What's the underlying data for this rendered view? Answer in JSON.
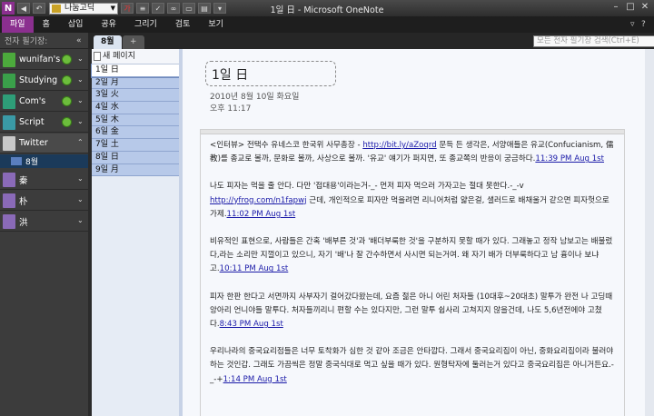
{
  "app": {
    "title": "1일 日 - Microsoft OneNote",
    "icon_letter": "N",
    "font_box": "나눔고딕"
  },
  "ribbon": {
    "tabs": [
      "파일",
      "홈",
      "삽입",
      "공유",
      "그리기",
      "검토",
      "보기"
    ]
  },
  "nav": {
    "header": "전자 필기장:",
    "notebooks": [
      {
        "name": "wunifan's",
        "color": "#4caa3c"
      },
      {
        "name": "Studying",
        "color": "#3aa04a"
      },
      {
        "name": "Com's",
        "color": "#2e9e78"
      },
      {
        "name": "Script",
        "color": "#3a9aa6"
      },
      {
        "name": "Twitter",
        "color": "#c8c8c8"
      }
    ],
    "twitter_section": "8월",
    "other_sections": [
      "秦",
      "朴",
      "洪"
    ]
  },
  "sections": {
    "tabs": [
      "8월",
      "+"
    ],
    "search_placeholder": "모든 전자 필기장 검색(Ctrl+E)"
  },
  "pages": {
    "add_label": "새 페이지",
    "items": [
      "1일 日",
      "2일 月",
      "3일 火",
      "4일 水",
      "5일 木",
      "6일 金",
      "7일 土",
      "8일 日",
      "9일 月"
    ]
  },
  "page": {
    "title": "1일 日",
    "date": "2010년 8월 10일 화요일",
    "time": "오후 11:17",
    "paragraphs": [
      {
        "text": "<인터뷰> 전택수 유네스코 한국위 사무총장 - ",
        "link": "http://bit.ly/aZoqrd",
        "rest": " 문득 든 생각은, 서양애들은 유교(Confucianism, 儒教)를 종교로 볼까, 문화로 볼까, 사상으로 볼까. '유교' 얘기가 퍼지면, 또 종교쪽의 반응이 궁금하다.",
        "stamp": "11:39 PM Aug 1st"
      },
      {
        "text": "나도 피자는 먹을 줄 안다. 다만 '접대용'이라는거-_- 먼저 피자 먹으러 가자고는 절대 못한다.-_-v ",
        "link": "http://yfrog.com/n1fapwj",
        "rest": " 근데, 개인적으로 피자만 먹을려면 리니어처럼 얇은걸, 샐러드로 배채울거 같으면 피자헛으로 가제.",
        "stamp": "11:02 PM Aug 1st"
      },
      {
        "text": "",
        "link": "",
        "rest": "비유적인 표현으로, 사람들은 간혹 '배부른 것'과 '배더부룩한 것'을 구분하지 못할 때가 있다. 그래놓고 정작 남보고는 배불렀다,라는 소리만 지껄이고 있으니, 자기 '배'나 잘 간수하면서 사시면 되는거여. 왜 자기 배가 더부룩하다고 남 흉이나 보냐고.",
        "stamp": "10:11 PM Aug 1st"
      },
      {
        "text": "",
        "link": "",
        "rest": "피자 한판 한다고 서면까지 사부자기 걸어갔다왔는데, 요즘 젊은 아니 어린 처자들 (10대후~20대초) 말투가 완전 나 고딩때 앙아리 언니야들 말투다. 처자들끼리니 편할 수는 있다지만, 그런 말투 쉽사리 고쳐지지 않을건데, 나도 5,6년전에야 고쳤다.",
        "stamp": "8:43 PM Aug 1st"
      },
      {
        "text": "",
        "link": "",
        "rest": "우리나라의 중국요리점들은 너무 토착화가 심한 것 같아 조금은 안타깝다. 그래서 중국요리집이 아닌, 중화요리집이라 불러야 하는 것인갑. 그래도 가끔씩은 정말 중국식대로 먹고 싶을 때가 있다. 원형탁자에 둘러는거 있다고 중국요리집은 아니거든요.-_-+",
        "stamp": "1:14 PM Aug 1st"
      }
    ]
  }
}
